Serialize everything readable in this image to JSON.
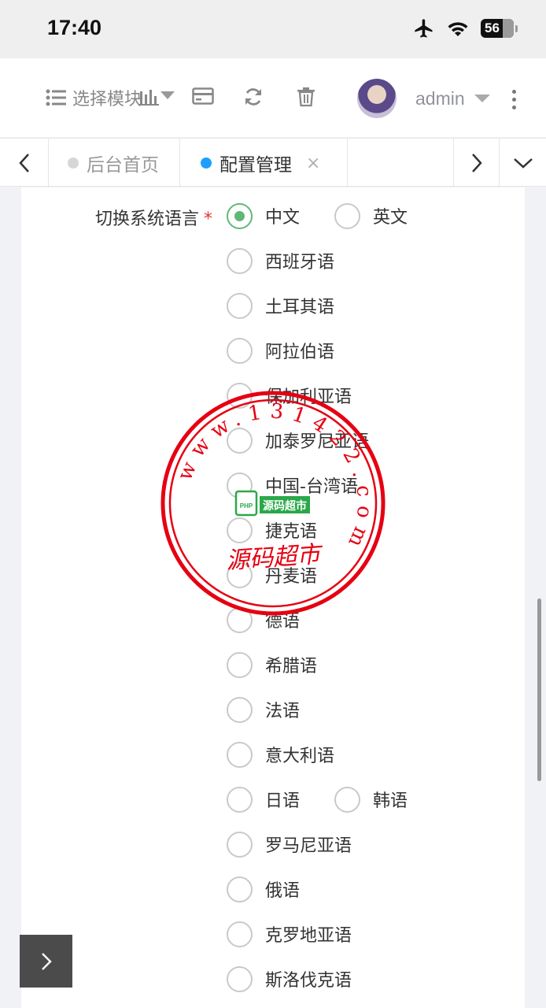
{
  "status": {
    "time": "17:40",
    "battery": "56"
  },
  "header": {
    "module_label": "选择模块",
    "username": "admin"
  },
  "tabs": [
    {
      "label": "后台首页",
      "active": false
    },
    {
      "label": "配置管理",
      "active": true,
      "close": "×"
    }
  ],
  "form": {
    "label": "切换系统语言",
    "required_mark": "*",
    "options": [
      {
        "label": "中文",
        "checked": true
      },
      {
        "label": "英文",
        "checked": false
      },
      {
        "label": "西班牙语",
        "checked": false
      },
      {
        "label": "土耳其语",
        "checked": false
      },
      {
        "label": "阿拉伯语",
        "checked": false
      },
      {
        "label": "保加利亚语",
        "checked": false
      },
      {
        "label": "加泰罗尼亚语",
        "checked": false
      },
      {
        "label": "中国-台湾语",
        "checked": false
      },
      {
        "label": "捷克语",
        "checked": false
      },
      {
        "label": "丹麦语",
        "checked": false
      },
      {
        "label": "德语",
        "checked": false
      },
      {
        "label": "希腊语",
        "checked": false
      },
      {
        "label": "法语",
        "checked": false
      },
      {
        "label": "意大利语",
        "checked": false
      },
      {
        "label": "日语",
        "checked": false
      },
      {
        "label": "韩语",
        "checked": false
      },
      {
        "label": "罗马尼亚语",
        "checked": false
      },
      {
        "label": "俄语",
        "checked": false
      },
      {
        "label": "克罗地亚语",
        "checked": false
      },
      {
        "label": "斯洛伐克语",
        "checked": false
      }
    ]
  },
  "watermark": {
    "ring_text": "www.131422.com",
    "brand_text": "源码超市",
    "logo_text": "源码超市",
    "logo_badge": "PHP"
  },
  "colors": {
    "accent": "#5fb878",
    "active_dot": "#1e9fff",
    "stamp": "#e60012",
    "required": "#e3342f"
  }
}
